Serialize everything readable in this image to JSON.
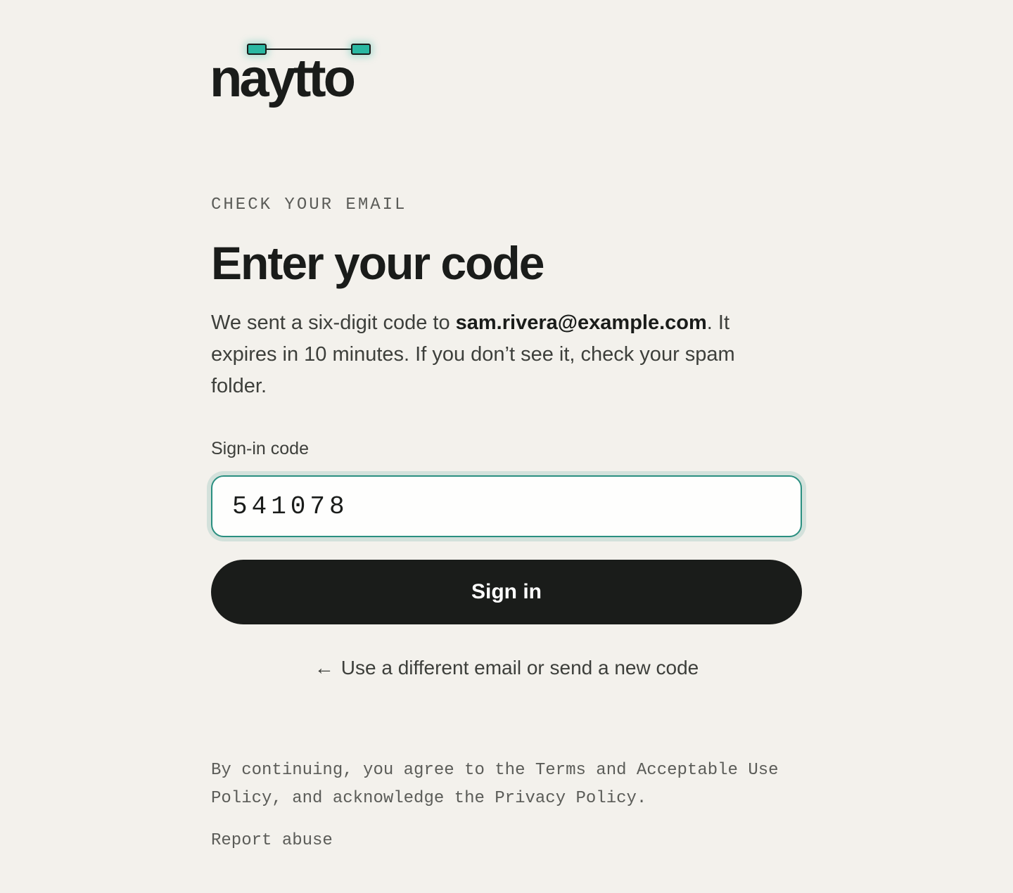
{
  "brand": {
    "name": "naytto",
    "accent_color": "#2ab8a2",
    "ink_color": "#1a1c1a"
  },
  "header": {
    "eyebrow": "CHECK YOUR EMAIL",
    "title": "Enter your code"
  },
  "description": {
    "prefix": "We sent a six-digit code to ",
    "email": "sam.rivera@example.com",
    "suffix": ". It expires in 10 minutes. If you don’t see it, check your spam folder."
  },
  "form": {
    "code_label": "Sign-in code",
    "code_value": "541078",
    "submit_label": "Sign in"
  },
  "back_link": {
    "icon": "arrow-left-icon",
    "arrow_glyph": "←",
    "label": "Use a different email or send a new code"
  },
  "footer": {
    "legal_prefix": "By continuing, you agree to the ",
    "terms_link": "Terms and Acceptable Use Policy",
    "legal_middle": ", and acknowledge the ",
    "privacy_link": "Privacy Policy",
    "legal_suffix": ".",
    "report_abuse": "Report abuse"
  }
}
